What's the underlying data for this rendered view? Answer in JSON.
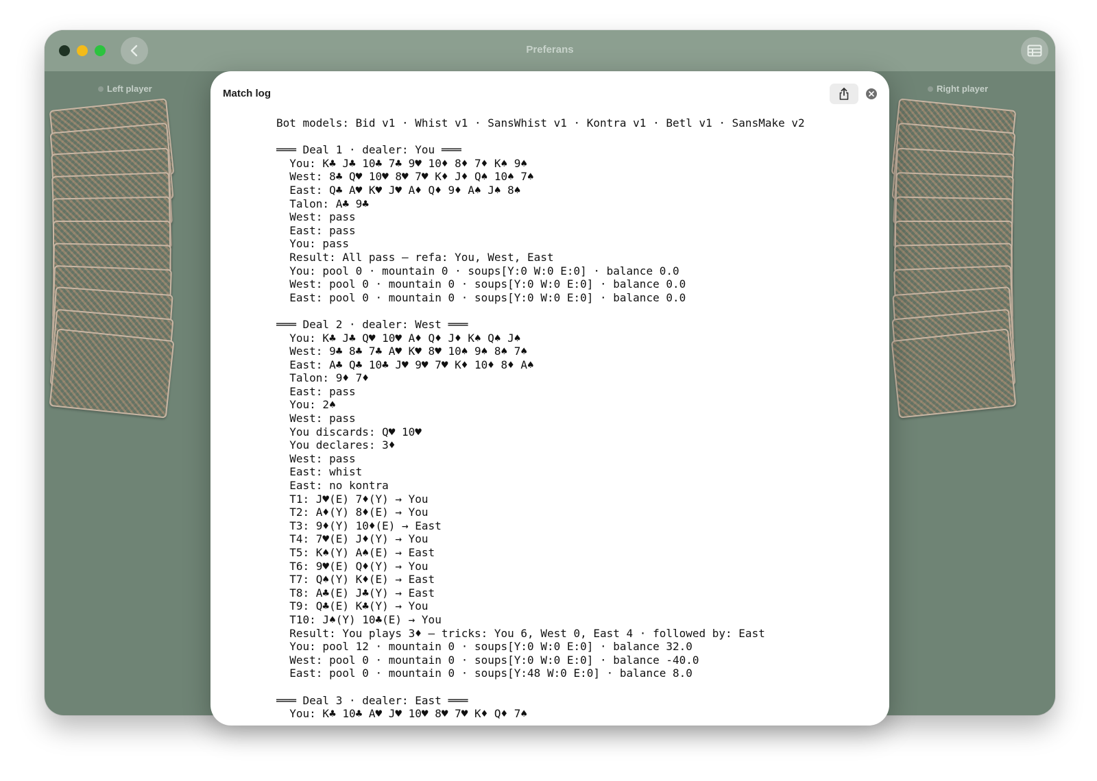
{
  "window": {
    "title": "Preferans",
    "left_player_label": "Left player",
    "right_player_label": "Right player"
  },
  "icons": {
    "back": "chevron-left-icon",
    "table": "table-icon",
    "share": "share-icon",
    "close": "close-icon"
  },
  "colors": {
    "felt": "#6f8475",
    "titlebar": "#8c9f90",
    "close_light": "#1f3324",
    "minimize_light": "#f3bb1a",
    "zoom_light": "#2cc33f"
  },
  "modal": {
    "title": "Match log",
    "lines": [
      "Bot models: Bid v1 · Whist v1 · SansWhist v1 · Kontra v1 · Betl v1 · SansMake v2",
      "",
      "═══ Deal 1 · dealer: You ═══",
      "  You: K♣ J♣ 10♣ 7♣ 9♥ 10♦ 8♦ 7♦ K♠ 9♠",
      "  West: 8♣ Q♥ 10♥ 8♥ 7♥ K♦ J♦ Q♠ 10♠ 7♠",
      "  East: Q♣ A♥ K♥ J♥ A♦ Q♦ 9♦ A♠ J♠ 8♠",
      "  Talon: A♣ 9♣",
      "  West: pass",
      "  East: pass",
      "  You: pass",
      "  Result: All pass — refa: You, West, East",
      "  You: pool 0 · mountain 0 · soups[Y:0 W:0 E:0] · balance 0.0",
      "  West: pool 0 · mountain 0 · soups[Y:0 W:0 E:0] · balance 0.0",
      "  East: pool 0 · mountain 0 · soups[Y:0 W:0 E:0] · balance 0.0",
      "",
      "═══ Deal 2 · dealer: West ═══",
      "  You: K♣ J♣ Q♥ 10♥ A♦ Q♦ J♦ K♠ Q♠ J♠",
      "  West: 9♣ 8♣ 7♣ A♥ K♥ 8♥ 10♠ 9♠ 8♠ 7♠",
      "  East: A♣ Q♣ 10♣ J♥ 9♥ 7♥ K♦ 10♦ 8♦ A♠",
      "  Talon: 9♦ 7♦",
      "  East: pass",
      "  You: 2♠",
      "  West: pass",
      "  You discards: Q♥ 10♥",
      "  You declares: 3♦",
      "  West: pass",
      "  East: whist",
      "  East: no kontra",
      "  T1: J♥(E) 7♦(Y) → You",
      "  T2: A♦(Y) 8♦(E) → You",
      "  T3: 9♦(Y) 10♦(E) → East",
      "  T4: 7♥(E) J♦(Y) → You",
      "  T5: K♠(Y) A♠(E) → East",
      "  T6: 9♥(E) Q♦(Y) → You",
      "  T7: Q♠(Y) K♦(E) → East",
      "  T8: A♣(E) J♣(Y) → East",
      "  T9: Q♣(E) K♣(Y) → You",
      "  T10: J♠(Y) 10♣(E) → You",
      "  Result: You plays 3♦ — tricks: You 6, West 0, East 4 · followed by: East",
      "  You: pool 12 · mountain 0 · soups[Y:0 W:0 E:0] · balance 32.0",
      "  West: pool 0 · mountain 0 · soups[Y:0 W:0 E:0] · balance -40.0",
      "  East: pool 0 · mountain 0 · soups[Y:48 W:0 E:0] · balance 8.0",
      "",
      "═══ Deal 3 · dealer: East ═══",
      "  You: K♣ 10♣ A♥ J♥ 10♥ 8♥ 7♥ K♦ Q♦ 7♠"
    ]
  }
}
